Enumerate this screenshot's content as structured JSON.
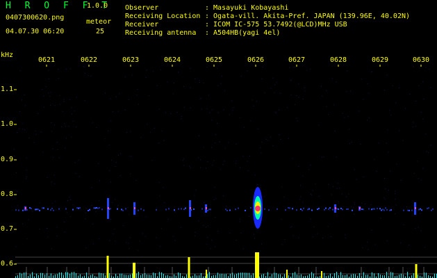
{
  "header": {
    "app_name": "H R O F F T",
    "version": "1.0.0",
    "filename": "0407300620.png",
    "datetime": "04.07.30 06:20",
    "meteor_label": "meteor",
    "meteor_count": "25"
  },
  "info": [
    {
      "label": "Observer",
      "value": ": Masayuki Kobayashi"
    },
    {
      "label": "Receiving Location",
      "value": ": Ogata-vill. Akita-Pref. JAPAN (139.96E, 40.02N)"
    },
    {
      "label": "Receiver",
      "value": ": ICOM IC-575 53.7492(@LCD)MHz USB"
    },
    {
      "label": "Receiving antenna",
      "value": ": A504HB(yagi 4el)"
    }
  ],
  "plot": {
    "unit_label": "kHz",
    "time_ticks": [
      "0621",
      "0622",
      "0623",
      "0624",
      "0625",
      "0626",
      "0627",
      "0628",
      "0629",
      "0630"
    ],
    "freq_ticks": [
      "1.1",
      "1.0",
      "0.9",
      "0.8",
      "0.7",
      "0.6"
    ]
  },
  "colors": {
    "background": "#000000",
    "text": "#ffff00",
    "title": "#00ff33",
    "level_bars": "#ffff00",
    "noise_bars": "#00ffff",
    "echo_core": "#ff3366"
  }
}
